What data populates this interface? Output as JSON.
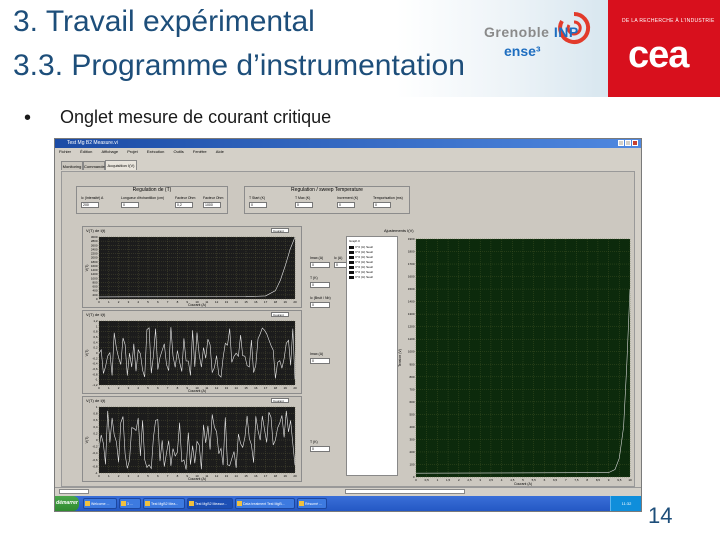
{
  "slide": {
    "title_line1": "3. Travail expérimental",
    "title_line2": "3.3. Programme d’instrumentation",
    "bullet_marker": "•",
    "bullet": "Onglet mesure de courant critique",
    "page_number": "14"
  },
  "logos": {
    "inp_name_prefix": "Grenoble ",
    "inp_name_suffix": "INP",
    "inp_school": "ense³",
    "cea_tagline": "DE LA RECHERCHE À L’INDUSTRIE",
    "cea_word": "cea"
  },
  "colors": {
    "title_blue": "#1d4e7a",
    "cea_red": "#d8101d",
    "plot_bg": "#1c1c1c",
    "big_plot_bg": "#0c2a0c",
    "trace": "#e8e8e8",
    "taskbar": "#2458c4"
  },
  "window": {
    "title": "Test Mg B2 Measure.vi",
    "menu": [
      "Fichier",
      "Édition",
      "Affichage",
      "Projet",
      "Exécution",
      "Outils",
      "Fenêtre",
      "Aide"
    ]
  },
  "tabs": [
    {
      "label": "Monitoring"
    },
    {
      "label": "Commande"
    },
    {
      "label": "Acquisition I(V)"
    }
  ],
  "regulation_group": {
    "title": "Regulation de (T)",
    "fields": [
      {
        "label": "Ic (Intensité) A",
        "value": "200"
      },
      {
        "label": "Longueur d'échantillon (cm)",
        "value": "0"
      },
      {
        "label": "Facteur Ohm",
        "value": "0,2"
      },
      {
        "label": "Facteur Ohm",
        "value": "1000"
      }
    ]
  },
  "temperature_group": {
    "title": "Regulation / sweep Temperature",
    "fields": [
      {
        "label": "T Start (K)",
        "value": "0"
      },
      {
        "label": "T Max (K)",
        "value": "0"
      },
      {
        "label": "Increment (K)",
        "value": "0"
      },
      {
        "label": "Temporisation (ms)",
        "value": "0"
      }
    ]
  },
  "plots": [
    {
      "title": "V(T) de I(t)",
      "selector": "Courant",
      "xlabel": "Courant (A)",
      "ylabel": "V(T)"
    },
    {
      "title": "V(T) de I(t)",
      "selector": "Courant",
      "xlabel": "Courant (A)",
      "ylabel": "V(T)"
    },
    {
      "title": "V(T) de I(t)",
      "selector": "Courant",
      "xlabel": "Courant (A)",
      "ylabel": "V(T)"
    }
  ],
  "side_readouts": [
    {
      "label": "Imax (A)",
      "value": "0"
    },
    {
      "label": "Ic (A)",
      "value": "0"
    },
    {
      "label": "T (K)",
      "value": "0"
    },
    {
      "label": "Ic (Bruit / Nb)",
      "value": "0"
    },
    {
      "label": "Imax (A)",
      "value": "0"
    },
    {
      "label": "T (K)",
      "value": "0"
    }
  ],
  "big_plot": {
    "title": "Ajustements I(V)",
    "legend_title": "Graph 0",
    "legend": [
      "V^2 (Ic) Seuil",
      "V^2 (Ic) Seuil",
      "V^2 (Ic) Seuil",
      "V^2 (Ic) Seuil",
      "V^2 (Ic) Seuil",
      "V^2 (Ic) Seuil",
      "V^2 (Ic) Seuil"
    ],
    "xlabel": "Courant (A)",
    "ylabel": "Tension (V)"
  },
  "taskbar": {
    "start": "démarrer",
    "tasks": [
      "Welcome ...",
      "3 ...",
      "Test MgB2 Mea...",
      "Test MgB2 Measur...",
      "Data treatment Test MgB...",
      "Résumé ..."
    ],
    "tray": "11:32"
  },
  "chart_data": [
    {
      "type": "line",
      "title": "V(T) de I(t)",
      "xlabel": "Courant (A)",
      "ylabel": "V(T)",
      "x_ticks": [
        "0",
        "1",
        "2",
        "3",
        "4",
        "5",
        "6",
        "7",
        "8",
        "9",
        "10",
        "11",
        "12",
        "13",
        "14",
        "15",
        "16",
        "17",
        "18",
        "19",
        "20"
      ],
      "y_ticks": [
        "0",
        "200",
        "400",
        "600",
        "800",
        "1000",
        "1200",
        "1400",
        "1600",
        "1800",
        "2000",
        "2200",
        "2400",
        "2600",
        "2800",
        "3000"
      ],
      "series": [
        {
          "x": [
            0,
            15,
            17,
            18,
            18.5,
            19,
            19.5,
            20
          ],
          "y": [
            100,
            110,
            150,
            400,
            900,
            1600,
            2400,
            3000
          ]
        }
      ]
    },
    {
      "type": "line",
      "title": "V(T) de I(t)",
      "xlabel": "Courant (A)",
      "ylabel": "V(T)",
      "x_ticks": [
        "0",
        "1",
        "2",
        "3",
        "4",
        "5",
        "6",
        "7",
        "8",
        "9",
        "10",
        "11",
        "12",
        "13",
        "14",
        "15",
        "16",
        "17",
        "18",
        "19",
        "20"
      ],
      "y_ticks": [
        "-1,2",
        "-1",
        "-0,8",
        "-0,6",
        "-0,4",
        "-0,2",
        "0",
        "0,2",
        "0,4",
        "0,6",
        "0,8",
        "1",
        "1,2"
      ],
      "series": [
        {
          "noise_amplitude": 1.0
        }
      ]
    },
    {
      "type": "line",
      "title": "V(T) de I(t)",
      "xlabel": "Courant (A)",
      "ylabel": "V(T)",
      "x_ticks": [
        "0",
        "1",
        "2",
        "3",
        "4",
        "5",
        "6",
        "7",
        "8",
        "9",
        "10",
        "11",
        "12",
        "13",
        "14",
        "15",
        "16",
        "17",
        "18",
        "19",
        "20"
      ],
      "y_ticks": [
        "-1",
        "-0,8",
        "-0,6",
        "-0,4",
        "-0,2",
        "0",
        "0,2",
        "0,4",
        "0,6",
        "0,8",
        "1"
      ],
      "series": [
        {
          "noise_amplitude": 0.9
        }
      ]
    },
    {
      "type": "line",
      "title": "Ajustements I(V)",
      "xlabel": "Courant (A)",
      "ylabel": "Tension (V)",
      "x_ticks": [
        "0",
        "0,5",
        "1",
        "1,5",
        "2",
        "2,5",
        "3",
        "3,5",
        "4",
        "4,5",
        "5",
        "5,5",
        "6",
        "6,5",
        "7",
        "7,5",
        "8",
        "8,5",
        "9",
        "9,5",
        "10"
      ],
      "y_ticks": [
        "0",
        "100",
        "200",
        "300",
        "400",
        "500",
        "600",
        "700",
        "800",
        "900",
        "1000",
        "1100",
        "1200",
        "1300",
        "1400",
        "1500",
        "1600",
        "1700",
        "1800",
        "1900"
      ],
      "series": [
        {
          "x": [
            0,
            9,
            9.3,
            9.5,
            9.7,
            9.85,
            10
          ],
          "y": [
            30,
            35,
            60,
            150,
            400,
            900,
            1500
          ]
        }
      ]
    }
  ]
}
